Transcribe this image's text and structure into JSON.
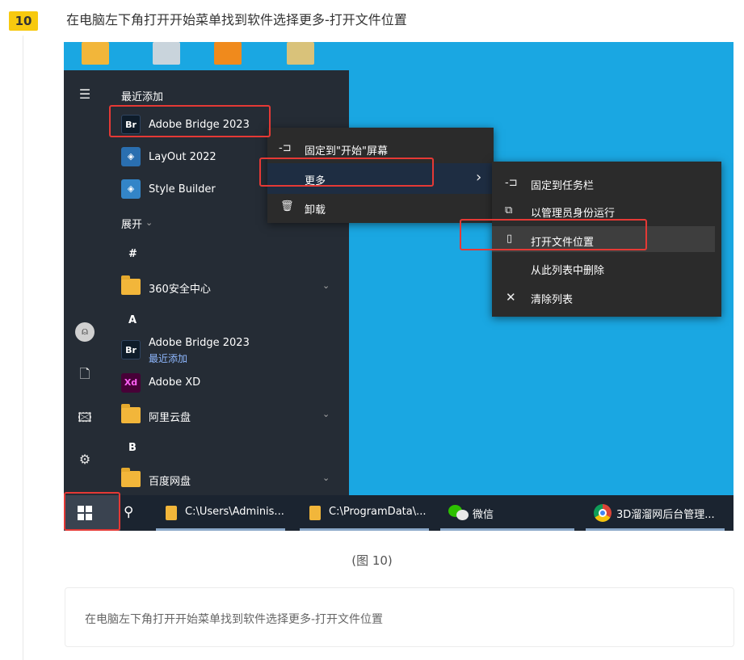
{
  "step": {
    "number": "10",
    "title": "在电脑左下角打开开始菜单找到软件选择更多-打开文件位置"
  },
  "start_menu": {
    "recent_header": "最近添加",
    "recent_items": [
      {
        "icon_text": "Br",
        "label": "Adobe Bridge 2023"
      },
      {
        "icon_text": "",
        "label": "LayOut 2022"
      },
      {
        "icon_text": "",
        "label": "Style Builder"
      }
    ],
    "expand_label": "展开",
    "groups": [
      {
        "letter": "#",
        "items": [
          {
            "label": "360安全中心",
            "kind": "folder"
          }
        ]
      },
      {
        "letter": "A",
        "items": [
          {
            "label": "Adobe Bridge 2023",
            "sub": "最近添加",
            "icon_text": "Br"
          },
          {
            "label": "Adobe XD",
            "icon_text": "Xd"
          },
          {
            "label": "阿里云盘",
            "kind": "folder"
          }
        ]
      },
      {
        "letter": "B",
        "items": [
          {
            "label": "百度网盘",
            "kind": "folder"
          }
        ]
      }
    ]
  },
  "context_menu": {
    "items": [
      {
        "icon": "-⊐",
        "label": "固定到\"开始\"屏幕"
      },
      {
        "icon": "",
        "label": "更多",
        "arrow": "›"
      },
      {
        "icon": "🗑",
        "label": "卸载"
      }
    ]
  },
  "submenu": {
    "items": [
      {
        "icon": "-⊐",
        "label": "固定到任务栏"
      },
      {
        "icon": "⧉",
        "label": "以管理员身份运行"
      },
      {
        "icon": "▯",
        "label": "打开文件位置"
      },
      {
        "icon": "",
        "label": "从此列表中删除"
      },
      {
        "icon": "✕",
        "label": "清除列表"
      }
    ]
  },
  "taskbar": {
    "items": [
      {
        "label": "C:\\Users\\Adminis..."
      },
      {
        "label": "C:\\ProgramData\\..."
      },
      {
        "label": "微信"
      },
      {
        "label": "3D溜溜网后台管理..."
      }
    ]
  },
  "caption": "(图 10)",
  "note": "在电脑左下角打开开始菜单找到软件选择更多-打开文件位置",
  "colors": {
    "badge": "#f7c90f",
    "highlight_box": "#e53935",
    "desktop": "#1aa7e2",
    "start_bg": "#252c35"
  }
}
